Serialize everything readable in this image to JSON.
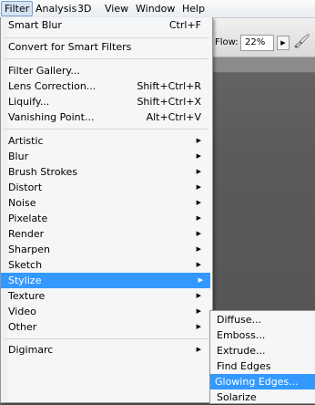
{
  "menubar": {
    "items": [
      "Filter",
      "Analysis",
      "3D",
      "View",
      "Window",
      "Help"
    ]
  },
  "options_bar": {
    "flow_label": "Flow:",
    "flow_value": "22%"
  },
  "filter_menu": {
    "smart_blur": {
      "label": "Smart Blur",
      "shortcut": "Ctrl+F"
    },
    "convert": {
      "label": "Convert for Smart Filters"
    },
    "filter_gallery": {
      "label": "Filter Gallery..."
    },
    "lens_correction": {
      "label": "Lens Correction...",
      "shortcut": "Shift+Ctrl+R"
    },
    "liquify": {
      "label": "Liquify...",
      "shortcut": "Shift+Ctrl+X"
    },
    "vanishing_point": {
      "label": "Vanishing Point...",
      "shortcut": "Alt+Ctrl+V"
    },
    "categories": [
      "Artistic",
      "Blur",
      "Brush Strokes",
      "Distort",
      "Noise",
      "Pixelate",
      "Render",
      "Sharpen",
      "Sketch",
      "Stylize",
      "Texture",
      "Video",
      "Other"
    ],
    "digimarc": "Digimarc"
  },
  "stylize_submenu": {
    "items": [
      "Diffuse...",
      "Emboss...",
      "Extrude...",
      "Find Edges",
      "Glowing Edges...",
      "Solarize"
    ]
  },
  "colors": {
    "highlight": "#3399ff"
  }
}
